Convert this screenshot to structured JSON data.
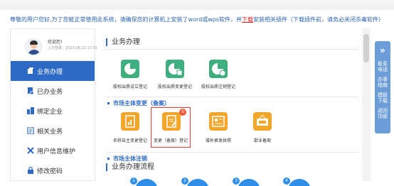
{
  "notice": {
    "prefix": "尊敬的用户您好,为了您能正常使用此系统，请确保您的计算机上安装了word或wps软件，并",
    "download": "下载",
    "suffix": "安装相关插件（下载插件前，请务必关闭杀毒软件）"
  },
  "user": {
    "welcome": "欢迎您!",
    "last_login": "上次登录：2023-06-21 17:01"
  },
  "nav": [
    {
      "label": "业务办理",
      "icon": "briefcase-icon",
      "active": true
    },
    {
      "label": "已办业务",
      "icon": "document-icon",
      "active": false
    },
    {
      "label": "绑定企业",
      "icon": "building-icon",
      "active": false
    },
    {
      "label": "相关业务",
      "icon": "list-icon",
      "active": false
    },
    {
      "label": "用户信息维护",
      "icon": "tools-icon",
      "active": false
    },
    {
      "label": "修改密码",
      "icon": "lock-icon",
      "active": false
    }
  ],
  "main": {
    "section1_title": "业务办理",
    "row1": [
      {
        "label": "股权出质设立登记",
        "icon": "pie-chart-icon"
      },
      {
        "label": "股权出质变更登记",
        "icon": "pie-edit-icon"
      },
      {
        "label": "股权出质注销登记",
        "icon": "pie-cancel-icon"
      }
    ],
    "sub1_title": "市场主体变更（备案）",
    "row2": [
      {
        "label": "名称自主变更登记",
        "icon": "doc-chart-icon"
      },
      {
        "label": "变更（备案）登记",
        "icon": "doc-edit-icon"
      },
      {
        "label": "增补换发执照",
        "icon": "license-icon"
      },
      {
        "label": "歇业备案",
        "icon": "closed-sign-icon"
      }
    ],
    "badge_count": "0",
    "sub2_title": "市场主体注销",
    "section2_title": "业务办理流程",
    "flow_steps": [
      "1",
      "2",
      "3",
      "4"
    ]
  },
  "right_panel": {
    "expand_icon": "double-chevron-right-icon",
    "links": [
      "联系电话",
      "办事指南",
      "模板下载",
      "返回顶部"
    ]
  },
  "colors": {
    "primary": "#2e6bc6",
    "tile_green": "#3fae7e",
    "tile_orange": "#f4a62a",
    "highlight": "#e53935",
    "download_link": "#e02020"
  }
}
